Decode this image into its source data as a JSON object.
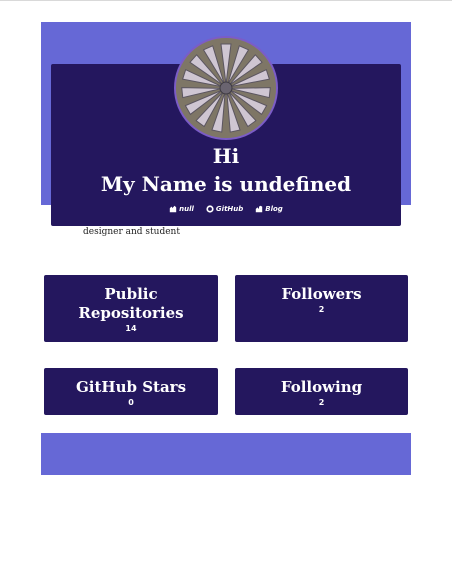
{
  "profile": {
    "greeting": "Hi",
    "name_line": "My Name is undefined",
    "bio": "designer and student",
    "avatar_alt": "shell-photo"
  },
  "links": [
    {
      "label": "null",
      "icon": "company-icon"
    },
    {
      "label": "GitHub",
      "icon": "github-icon"
    },
    {
      "label": "Blog",
      "icon": "blog-icon"
    }
  ],
  "stats": [
    {
      "label": "Public Repositories",
      "value": "14"
    },
    {
      "label": "Followers",
      "value": "2"
    },
    {
      "label": "GitHub Stars",
      "value": "0"
    },
    {
      "label": "Following",
      "value": "2"
    }
  ],
  "colors": {
    "accent": "#6668d6",
    "card": "#24175e",
    "avatar_border": "#7b5cc7"
  }
}
